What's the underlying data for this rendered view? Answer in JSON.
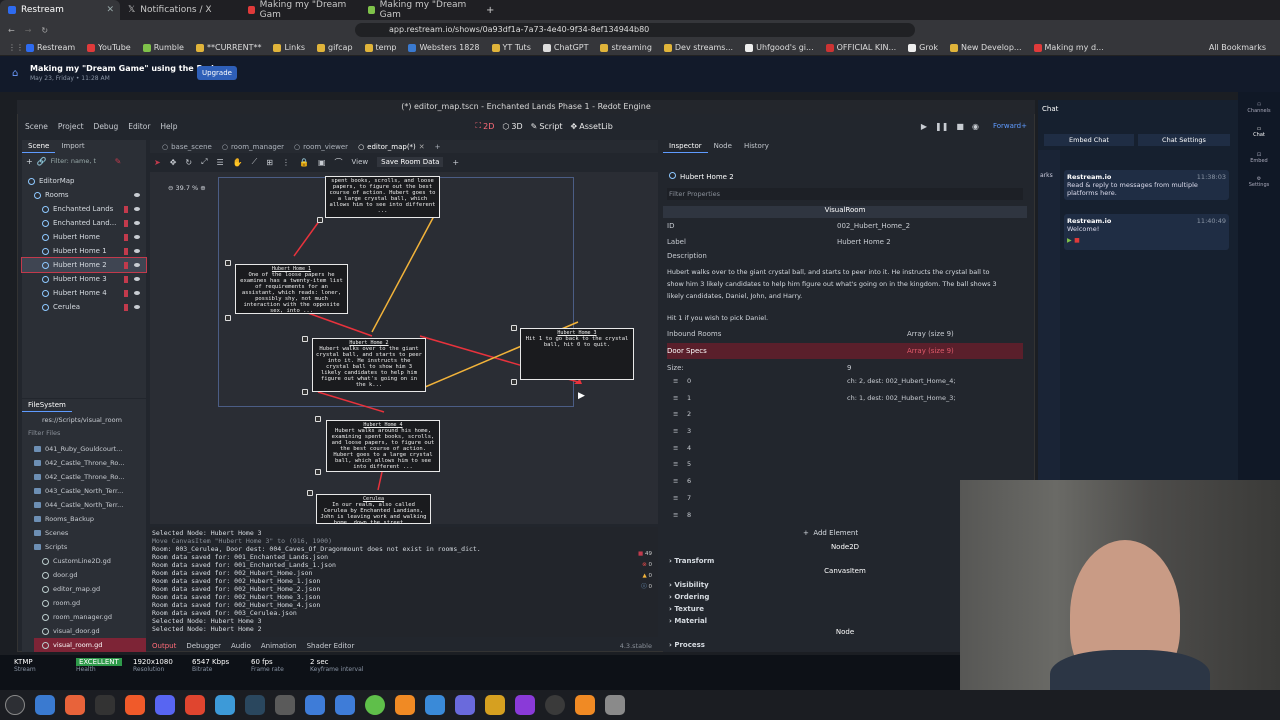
{
  "browser": {
    "tabs": [
      {
        "label": "Restream",
        "active": true
      },
      {
        "label": "Notifications / X",
        "active": false
      },
      {
        "label": "Making my \"Dream Gam",
        "active": false
      },
      {
        "label": "Making my \"Dream Gam",
        "active": false
      }
    ],
    "url": "app.restream.io/shows/0a93df1a-7a73-4e40-9f34-8ef134944b80",
    "bookmarks": [
      "Restream",
      "YouTube",
      "Rumble",
      "**CURRENT**",
      "Links",
      "gifcap",
      "temp",
      "Websters 1828",
      "YT Tuts",
      "ChatGPT",
      "streaming",
      "Dev streams...",
      "Uhfgood's gi...",
      "OFFICIAL KIN...",
      "Grok",
      "New Develop...",
      "Making my d..."
    ],
    "all_bookmarks": "All Bookmarks"
  },
  "restream": {
    "show_title": "Making my \"Dream Game\" using the Redo...",
    "show_date": "May 23, Friday • 11:28 AM",
    "upgrade": "Upgrade",
    "stats": [
      {
        "value": "KTMP",
        "label": "Stream"
      },
      {
        "value": "EXCELLENT",
        "label": "Health"
      },
      {
        "value": "1920x1080",
        "label": "Resolution"
      },
      {
        "value": "6547 Kbps",
        "label": "Bitrate"
      },
      {
        "value": "60 fps",
        "label": "Frame rate"
      },
      {
        "value": "2 sec",
        "label": "Keyframe interval"
      }
    ],
    "chat_title": "Chat",
    "embed_chat": "Embed Chat",
    "chat_settings": "Chat Settings",
    "messages": [
      {
        "author": "Restream.io",
        "time": "11:38:03",
        "text": "Read & reply to messages from multiple platforms here."
      },
      {
        "author": "Restream.io",
        "time": "11:40:49",
        "text": "Welcome!"
      }
    ],
    "right_rail": [
      "Channels",
      "Chat",
      "Embed",
      "Settings"
    ],
    "sidebar_letters": "arks"
  },
  "godot": {
    "title": "(*) editor_map.tscn - Enchanted Lands Phase 1 - Redot Engine",
    "menus": [
      "Scene",
      "Project",
      "Debug",
      "Editor",
      "Help"
    ],
    "workspaces": [
      "2D",
      "3D",
      "Script",
      "AssetLib"
    ],
    "active_workspace": "2D",
    "renderer": "Forward+",
    "scene_dock": {
      "tabs": [
        "Scene",
        "Import"
      ],
      "filter_placeholder": "Filter: name, t",
      "tree": [
        {
          "label": "EditorMap",
          "depth": 0
        },
        {
          "label": "Rooms",
          "depth": 1
        },
        {
          "label": "Enchanted Lands",
          "depth": 2
        },
        {
          "label": "Enchanted Land...",
          "depth": 2
        },
        {
          "label": "Hubert Home",
          "depth": 2
        },
        {
          "label": "Hubert Home 1",
          "depth": 2
        },
        {
          "label": "Hubert Home 2",
          "depth": 2,
          "selected": true
        },
        {
          "label": "Hubert Home 3",
          "depth": 2
        },
        {
          "label": "Hubert Home 4",
          "depth": 2
        },
        {
          "label": "Cerulea",
          "depth": 2
        }
      ]
    },
    "filesystem": {
      "title": "FileSystem",
      "path": "res://Scripts/visual_room",
      "filter_placeholder": "Filter Files",
      "items": [
        {
          "label": "041_Ruby_Gouldcourt...",
          "type": "folder"
        },
        {
          "label": "042_Castle_Throne_Ro...",
          "type": "folder"
        },
        {
          "label": "042_Castle_Throne_Ro...",
          "type": "folder"
        },
        {
          "label": "043_Castle_North_Terr...",
          "type": "folder"
        },
        {
          "label": "044_Castle_North_Terr...",
          "type": "folder"
        },
        {
          "label": "Rooms_Backup",
          "type": "folder"
        },
        {
          "label": "Scenes",
          "type": "folder"
        },
        {
          "label": "Scripts",
          "type": "folder"
        },
        {
          "label": "CustomLine2D.gd",
          "type": "script"
        },
        {
          "label": "door.gd",
          "type": "script"
        },
        {
          "label": "editor_map.gd",
          "type": "script"
        },
        {
          "label": "room.gd",
          "type": "script"
        },
        {
          "label": "room_manager.gd",
          "type": "script"
        },
        {
          "label": "visual_door.gd",
          "type": "script"
        },
        {
          "label": "visual_room.gd",
          "type": "script",
          "selected": true
        }
      ]
    },
    "editor_tabs": [
      "base_scene",
      "room_manager",
      "room_viewer",
      "editor_map(*)"
    ],
    "toolbar": {
      "view": "View",
      "save_room_data": "Save Room Data",
      "zoom": "39.7 %"
    },
    "map_nodes": [
      {
        "title": "",
        "text": "spent books, scrolls, and loose papers, to figure out the best course of action. Hubert goes to a large crystal ball, which allows him to see into different ..."
      },
      {
        "title": "Hubert Home 1",
        "text": "One of the loose papers he examines has a twenty-item list of requirements for an assistant, which reads: loner, possibly shy, not much interaction with the opposite sex, into ..."
      },
      {
        "title": "Hubert Home 2",
        "text": "Hubert walks over to the giant crystal ball, and starts to peer into it. He instructs the crystal ball to show him 3 likely candidates to help him figure out what's going on in the k..."
      },
      {
        "title": "Hubert Home 3",
        "text": "Hit 1 to go back to the crystal ball, hit 0 to quit."
      },
      {
        "title": "Hubert Home 4",
        "text": "Hubert walks around his home, examining spent books, scrolls, and loose papers, to figure out the best course of action. Hubert goes to a large crystal ball, which allows him to see into different ..."
      },
      {
        "title": "Cerulea",
        "text": "In our realm, also called Cerulea by Enchanted Landians, John is leaving work and walking home, down the street..."
      }
    ],
    "output": [
      {
        "text": "Selected Node: Hubert Home 3",
        "dim": false
      },
      {
        "text": "Move CanvasItem \"Hubert Home 3\" to (916, 1900)",
        "dim": true
      },
      {
        "text": "Room: 003_Cerulea, Door dest: 004_Caves_Of_Dragonmount does not exist in rooms_dict.",
        "dim": false
      },
      {
        "text": "Room data saved for: 001_Enchanted_Lands.json",
        "dim": false
      },
      {
        "text": "Room data saved for: 001_Enchanted_Lands_1.json",
        "dim": false
      },
      {
        "text": "Room data saved for: 002_Hubert_Home.json",
        "dim": false
      },
      {
        "text": "Room data saved for: 002_Hubert_Home_1.json",
        "dim": false
      },
      {
        "text": "Room data saved for: 002_Hubert_Home_2.json",
        "dim": false
      },
      {
        "text": "Room data saved for: 002_Hubert_Home_3.json",
        "dim": false
      },
      {
        "text": "Room data saved for: 002_Hubert_Home_4.json",
        "dim": false
      },
      {
        "text": "Room data saved for: 003_Cerulea.json",
        "dim": false
      },
      {
        "text": "Selected Node: Hubert Home 3",
        "dim": false
      },
      {
        "text": "Selected Node: Hubert Home 2",
        "dim": false
      }
    ],
    "output_counts": [
      "49",
      "0",
      "0",
      "0"
    ],
    "bottom_tabs": [
      "Output",
      "Debugger",
      "Audio",
      "Animation",
      "Shader Editor"
    ],
    "version": "4.3.stable",
    "inspector": {
      "tabs": [
        "Inspector",
        "Node",
        "History"
      ],
      "node_name": "Hubert Home 2",
      "filter_placeholder": "Filter Properties",
      "class": "VisualRoom",
      "id_label": "ID",
      "id_value": "002_Hubert_Home_2",
      "label_label": "Label",
      "label_value": "Hubert Home 2",
      "description_label": "Description",
      "description": "Hubert walks over to the giant crystal ball, and starts to peer into it.  He instructs the crystal ball to show him 3 likely candidates to help him figure out what's going on in the kingdom.  The ball shows 3 likely candidates, Daniel, John, and Harry.",
      "description_tail": "Hit 1 if you wish to pick Daniel.",
      "inbound_label": "Inbound Rooms",
      "inbound_value": "Array (size 9)",
      "door_label": "Door Specs",
      "door_value": "Array (size 9)",
      "size_label": "Size:",
      "size_value": "9",
      "door_items": [
        {
          "index": "0",
          "value": "ch: 2, dest: 002_Hubert_Home_4;"
        },
        {
          "index": "1",
          "value": "ch: 1, dest: 002_Hubert_Home_3;"
        },
        {
          "index": "2",
          "value": ""
        },
        {
          "index": "3",
          "value": ""
        },
        {
          "index": "4",
          "value": ""
        },
        {
          "index": "5",
          "value": ""
        },
        {
          "index": "6",
          "value": ""
        },
        {
          "index": "7",
          "value": ""
        },
        {
          "index": "8",
          "value": ""
        }
      ],
      "add_element": "Add Element",
      "node2d": "Node2D",
      "transform": "Transform",
      "canvas_item": "CanvasItem",
      "canvas_sections": [
        "Visibility",
        "Ordering",
        "Texture",
        "Material"
      ],
      "node": "Node",
      "process": "Process"
    }
  },
  "colors": {
    "accent_red": "#c23a4c",
    "link_yellow": "#f2b33a",
    "link_red": "#e8323c",
    "accent_blue": "#5f9bff"
  }
}
